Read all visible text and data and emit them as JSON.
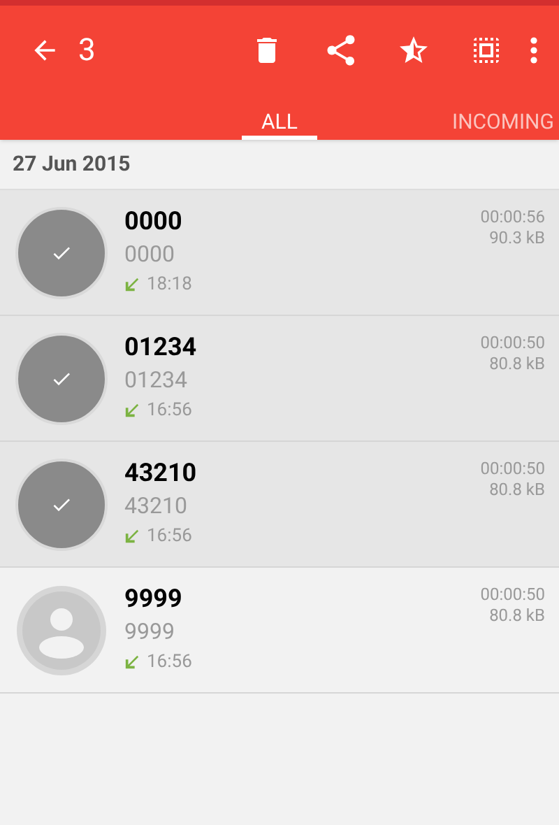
{
  "toolbar": {
    "count": "3"
  },
  "tabs": [
    {
      "label": "ALL",
      "selected": true
    },
    {
      "label": "INCOMING",
      "selected": false
    }
  ],
  "date_header": "27 Jun 2015",
  "calls": [
    {
      "name": "0000",
      "number": "0000",
      "time": "18:18",
      "duration": "00:00:56",
      "size": "90.3 kB",
      "selected": true
    },
    {
      "name": "01234",
      "number": "01234",
      "time": "16:56",
      "duration": "00:00:50",
      "size": "80.8 kB",
      "selected": true
    },
    {
      "name": "43210",
      "number": "43210",
      "time": "16:56",
      "duration": "00:00:50",
      "size": "80.8 kB",
      "selected": true
    },
    {
      "name": "9999",
      "number": "9999",
      "time": "16:56",
      "duration": "00:00:50",
      "size": "80.8 kB",
      "selected": false
    }
  ]
}
